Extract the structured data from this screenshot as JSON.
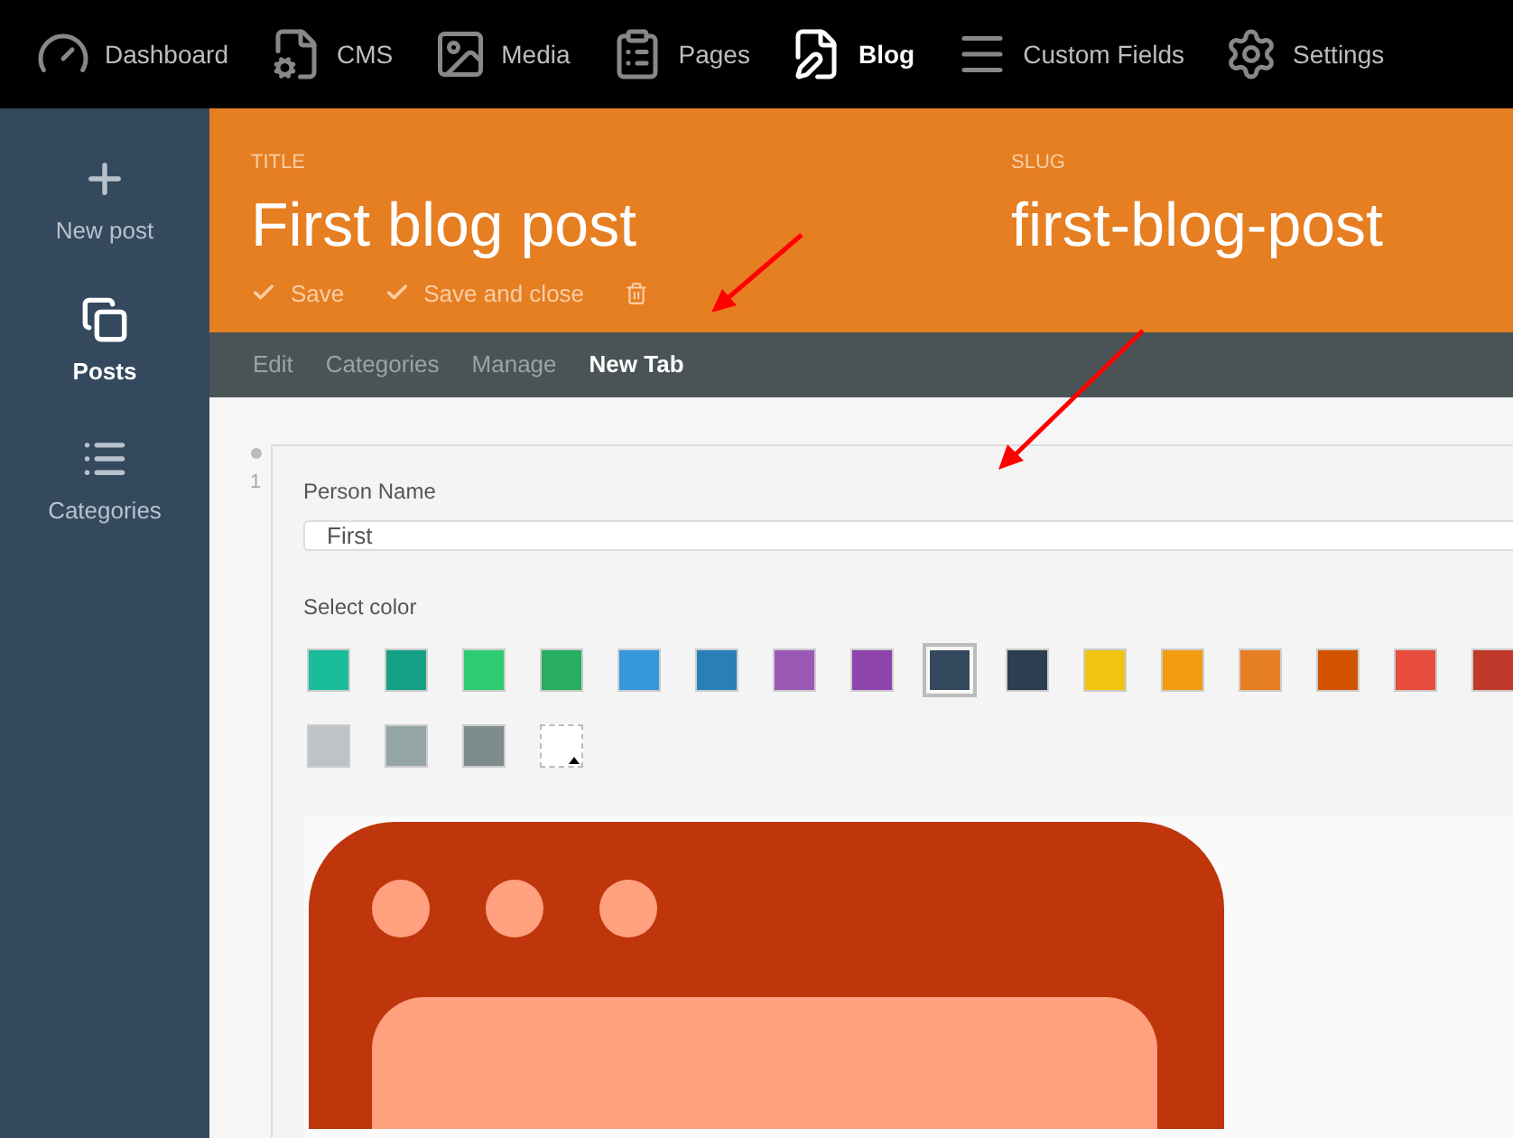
{
  "top_nav": [
    {
      "label": "Dashboard",
      "selected": false
    },
    {
      "label": "CMS",
      "selected": false
    },
    {
      "label": "Media",
      "selected": false
    },
    {
      "label": "Pages",
      "selected": false
    },
    {
      "label": "Blog",
      "selected": true
    },
    {
      "label": "Custom Fields",
      "selected": false
    },
    {
      "label": "Settings",
      "selected": false
    }
  ],
  "sidebar": {
    "items": [
      {
        "label": "New post",
        "selected": false
      },
      {
        "label": "Posts",
        "selected": true
      },
      {
        "label": "Categories",
        "selected": false
      }
    ]
  },
  "header": {
    "title_label": "TITLE",
    "title": "First blog post",
    "slug_label": "SLUG",
    "slug": "first-blog-post",
    "actions": [
      "Save",
      "Save and close"
    ]
  },
  "tabs": [
    {
      "label": "Edit",
      "selected": false
    },
    {
      "label": "Categories",
      "selected": false
    },
    {
      "label": "Manage",
      "selected": false
    },
    {
      "label": "New Tab",
      "selected": true
    }
  ],
  "block": {
    "row_number": "1",
    "name_label": "Person Name",
    "name_value": "First",
    "color_label": "Select color",
    "colors": [
      {
        "color": "#1abc9c",
        "selected": false
      },
      {
        "color": "#16a085",
        "selected": false
      },
      {
        "color": "#2ecc71",
        "selected": false
      },
      {
        "color": "#27ae60",
        "selected": false
      },
      {
        "color": "#3498db",
        "selected": false
      },
      {
        "color": "#2980b9",
        "selected": false
      },
      {
        "color": "#9b59b6",
        "selected": false
      },
      {
        "color": "#8e44ad",
        "selected": false
      },
      {
        "color": "#34495e",
        "selected": true
      },
      {
        "color": "#2c3e50",
        "selected": false
      },
      {
        "color": "#f1c40f",
        "selected": false
      },
      {
        "color": "#f39c12",
        "selected": false
      },
      {
        "color": "#e67e22",
        "selected": false
      },
      {
        "color": "#d35400",
        "selected": false
      },
      {
        "color": "#e74c3c",
        "selected": false
      },
      {
        "color": "#c0392b",
        "selected": false
      },
      {
        "color": "#bdc3c7",
        "selected": false
      },
      {
        "color": "#95a5a6",
        "selected": false
      },
      {
        "color": "#7f8c8d",
        "selected": false
      }
    ]
  }
}
